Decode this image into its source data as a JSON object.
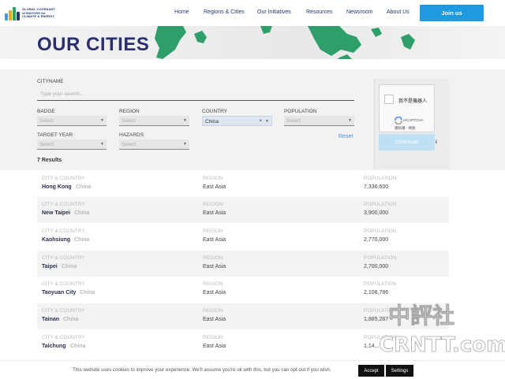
{
  "header": {
    "logo_lines": [
      "GLOBAL COVENANT",
      "of MAYORS for",
      "CLIMATE & ENERGY"
    ],
    "nav": [
      "Home",
      "Regions & Cities",
      "Our Initiatives",
      "Resources",
      "Newsroom",
      "About Us"
    ],
    "join_label": "Join us",
    "colors": {
      "primary": "#1e9be0",
      "navy": "#2b2f6b"
    }
  },
  "banner": {
    "title": "OUR CITIES"
  },
  "filters": {
    "cityname_label": "CITYNAME",
    "search_placeholder": "Type your search...",
    "badge": {
      "label": "BADGE",
      "value": "Select"
    },
    "region": {
      "label": "REGION",
      "value": "Select"
    },
    "country": {
      "label": "COUNTRY",
      "value": "China",
      "clear": "×"
    },
    "population": {
      "label": "POPULATION",
      "value": "Select"
    },
    "target_year": {
      "label": "TARGET YEAR",
      "value": "Select"
    },
    "hazards": {
      "label": "HAZARDS",
      "value": "Select"
    },
    "reset_label": "Reset"
  },
  "captcha": {
    "checkbox_label": "我不是機器人",
    "brand": "reCAPTCHA",
    "terms": "隱私權 - 條款"
  },
  "download_label": "Download",
  "results": {
    "count_label": "7 Results",
    "col_city_label": "CITY & COUNTRY",
    "col_region_label": "REGION",
    "col_population_label": "POPULATION",
    "rows": [
      {
        "city": "Hong Kong",
        "country": "China",
        "region": "East Asia",
        "population": "7,336,600"
      },
      {
        "city": "New Taipei",
        "country": "China",
        "region": "East Asia",
        "population": "3,900,000"
      },
      {
        "city": "Kaohsiung",
        "country": "China",
        "region": "East Asia",
        "population": "2,770,000"
      },
      {
        "city": "Taipei",
        "country": "China",
        "region": "East Asia",
        "population": "2,700,000"
      },
      {
        "city": "Taoyuan City",
        "country": "China",
        "region": "East Asia",
        "population": "2,108,786"
      },
      {
        "city": "Tainan",
        "country": "China",
        "region": "East Asia",
        "population": "1,885,287"
      },
      {
        "city": "Taichung",
        "country": "China",
        "region": "East Asia",
        "population": "1,14..."
      }
    ]
  },
  "cookie": {
    "text": "This website uses cookies to improve your experience. We'll assume you're ok with this, but you can opt-out if you wish.",
    "accept_label": "Accept",
    "settings_label": "Settings"
  },
  "watermark": {
    "line1": "中評社",
    "line2": "CRNTT.com"
  }
}
